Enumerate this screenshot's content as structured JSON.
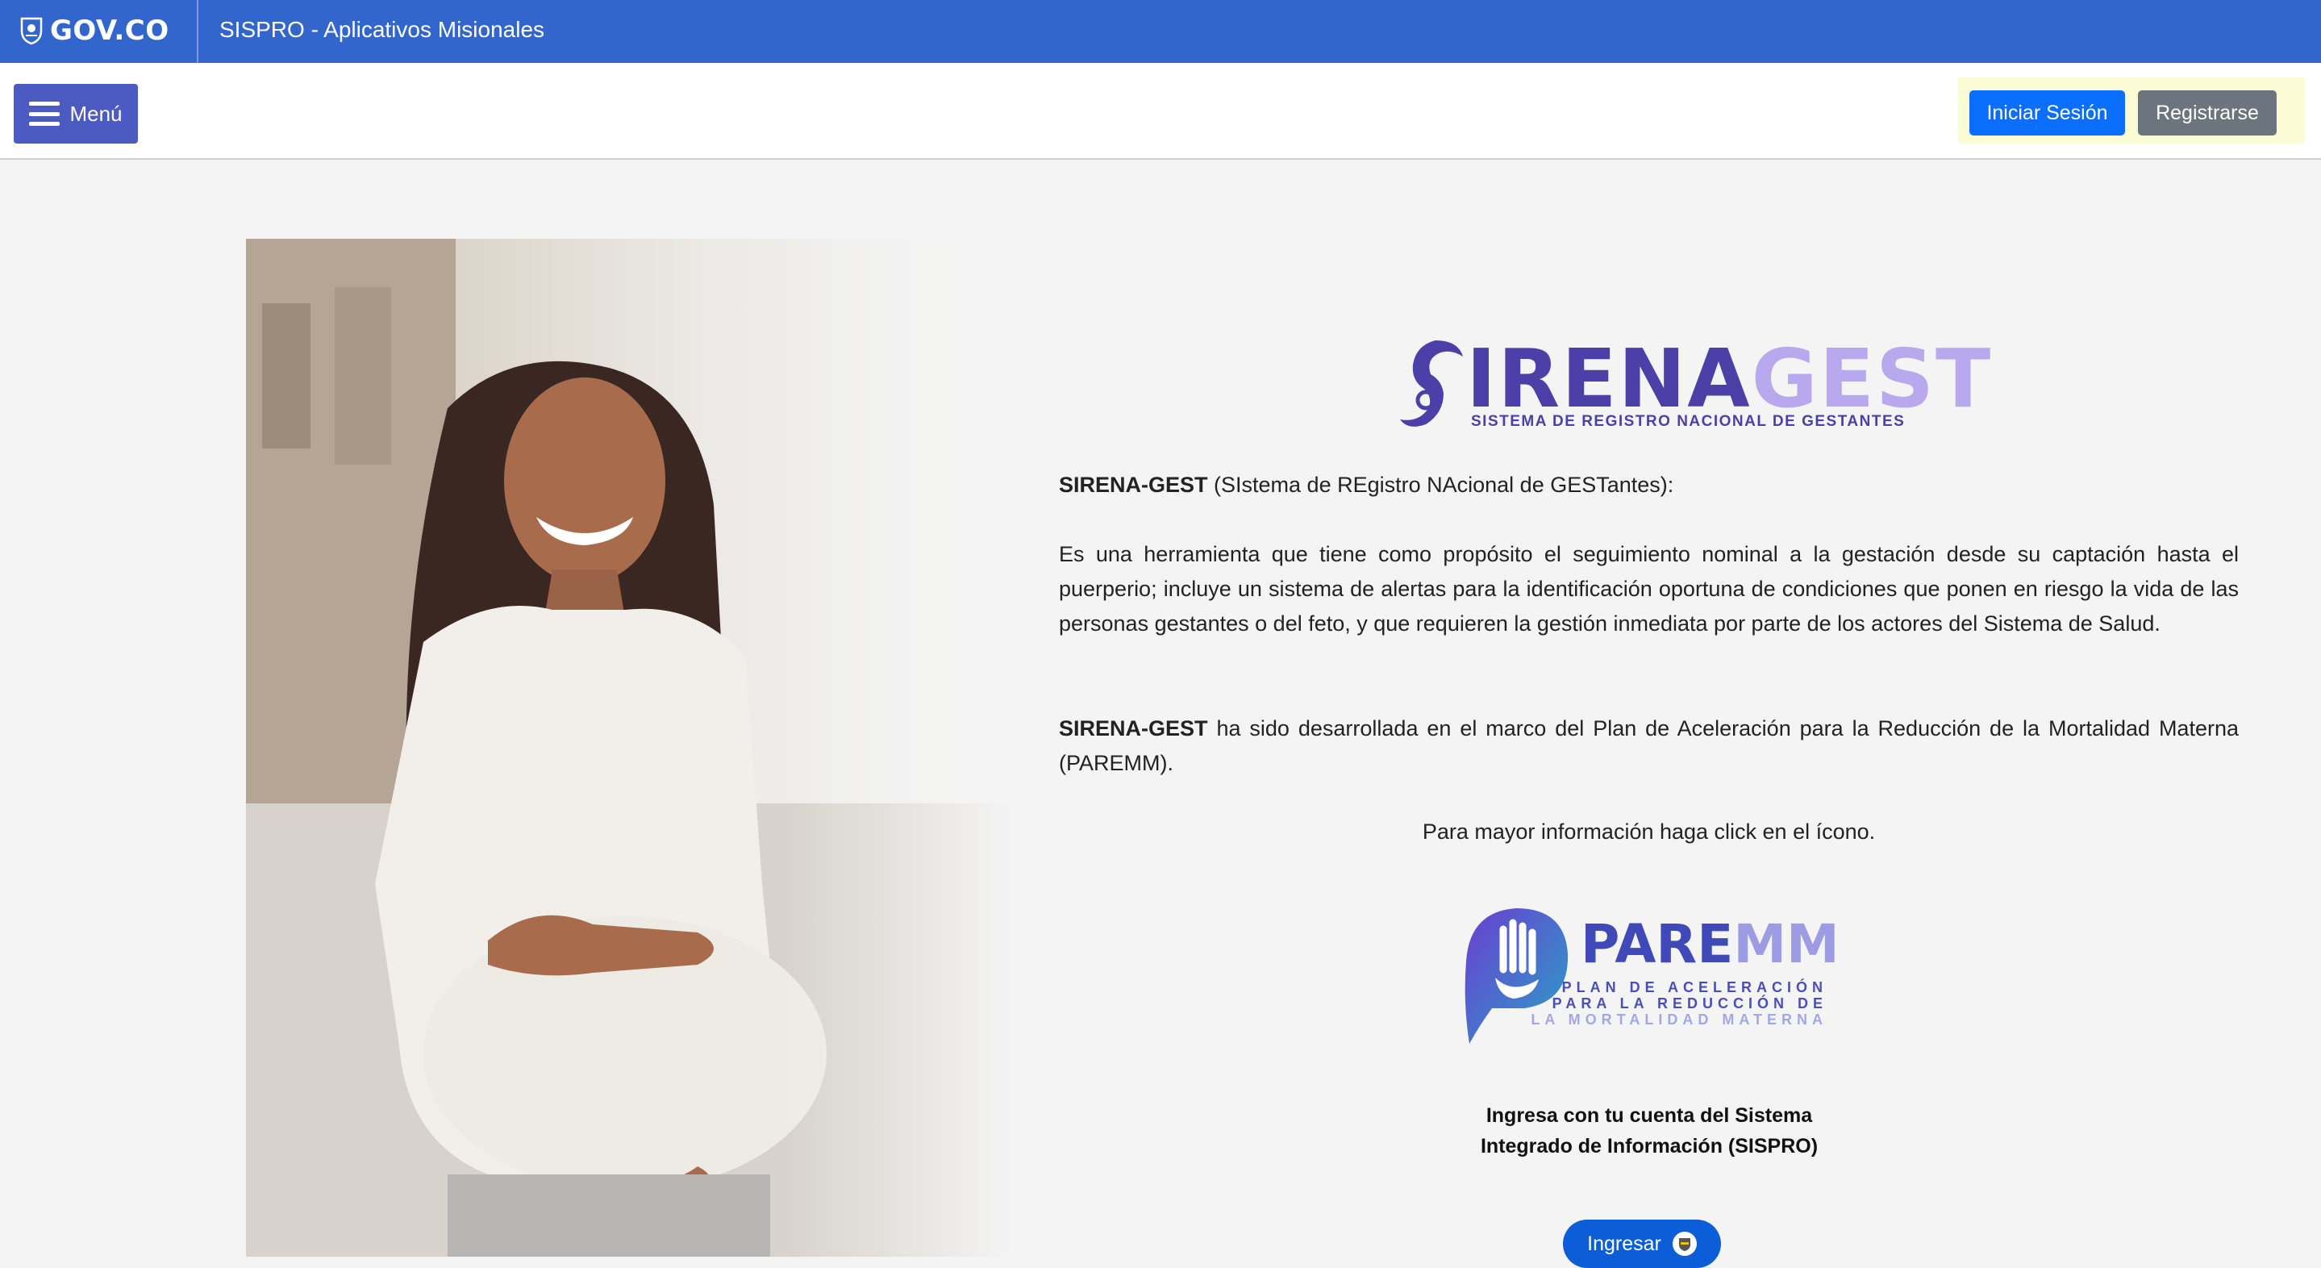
{
  "gov_bar": {
    "logo_text": "GOV.CO",
    "app_title": "SISPRO - Aplicativos Misionales"
  },
  "navbar": {
    "menu_label": "Menú",
    "login_label": "Iniciar Sesión",
    "register_label": "Registrarse"
  },
  "brand": {
    "name_part1": "IRENA",
    "name_part2": "GEST",
    "subtitle": "SISTEMA DE REGISTRO NACIONAL DE GESTANTES"
  },
  "intro": {
    "term": "SIRENA-GEST",
    "expansion": " (SIstema de REgistro NAcional de GESTantes):"
  },
  "description": "Es una herramienta que tiene como propósito el seguimiento nominal a la gestación desde su captación hasta el puerperio; incluye un sistema de alertas para la identificación oportuna de condiciones que ponen en riesgo la vida de las personas gestantes o del feto, y que requieren la gestión inmediata por parte de los actores del Sistema de Salud.",
  "framework": {
    "term": "SIRENA-GEST",
    "text": " ha sido desarrollada en el marco del Plan de Aceleración para la Reducción de la Mortalidad Materna (PAREMM)."
  },
  "more_info": "Para mayor información haga click en el ícono.",
  "paremm": {
    "title_part1": "PARE",
    "title_part2": "MM",
    "line1": "PLAN DE ACELERACIÓN",
    "line2": "PARA LA REDUCCIÓN DE",
    "line3": "LA MORTALIDAD MATERNA"
  },
  "login_note": {
    "line1": "Ingresa con tu cuenta del Sistema",
    "line2": "Integrado de Información (SISPRO)"
  },
  "ingresar_label": "Ingresar",
  "colors": {
    "gov_blue": "#3366cc",
    "menu_blue": "#4b5bc1",
    "primary": "#0b6efd",
    "secondary": "#6c757d",
    "brand_purple": "#4d3fa8",
    "brand_lilac": "#b8a8ee"
  }
}
